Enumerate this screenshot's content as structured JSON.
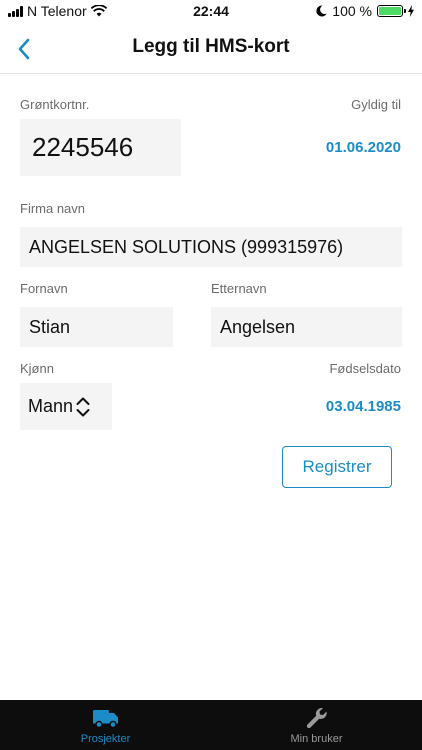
{
  "status": {
    "carrier": "N Telenor",
    "time": "22:44",
    "battery_text": "100 %",
    "battery_level": 1.0
  },
  "navbar": {
    "title": "Legg til HMS-kort"
  },
  "form": {
    "card_number_label": "Grøntkortnr.",
    "card_number_value": "2245546",
    "valid_until_label": "Gyldig til",
    "valid_until_value": "01.06.2020",
    "company_label": "Firma navn",
    "company_value": "ANGELSEN SOLUTIONS (999315976)",
    "first_name_label": "Fornavn",
    "first_name_value": "Stian",
    "last_name_label": "Etternavn",
    "last_name_value": "Angelsen",
    "gender_label": "Kjønn",
    "gender_value": "Mann",
    "birth_date_label": "Fødselsdato",
    "birth_date_value": "03.04.1985",
    "register_label": "Registrer"
  },
  "tabbar": {
    "tabs": [
      {
        "label": "Prosjekter",
        "icon": "truck-icon",
        "active": true
      },
      {
        "label": "Min bruker",
        "icon": "wrench-icon",
        "active": false
      }
    ],
    "active_color": "#1b8cc8",
    "inactive_color": "#9a9a9a"
  },
  "colors": {
    "accent": "#1b8cc8",
    "field_bg": "#f4f4f4"
  }
}
